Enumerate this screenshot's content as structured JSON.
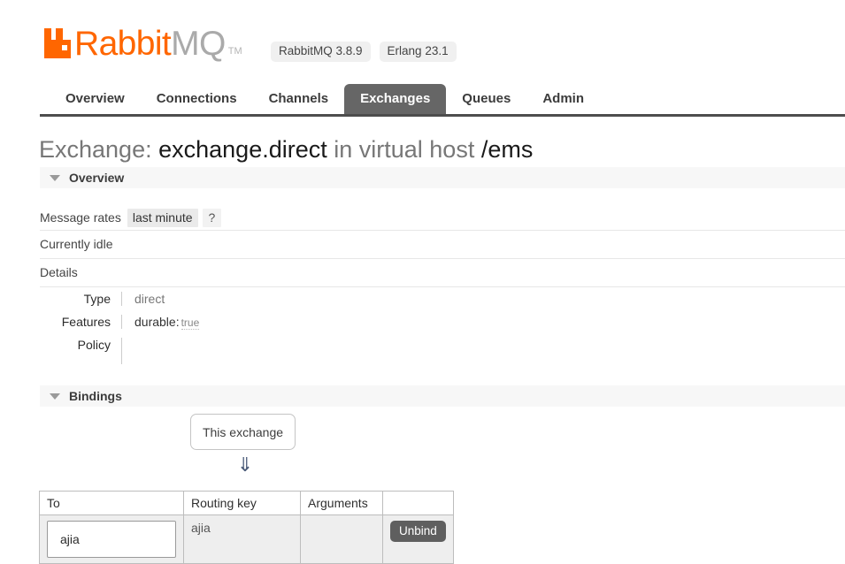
{
  "header": {
    "logo": {
      "icon_name": "rabbitmq-logo-icon",
      "text_primary": "Rabbit",
      "text_secondary": "MQ",
      "trademark": "TM",
      "color": "#ff6600"
    },
    "badges": [
      {
        "label": "RabbitMQ 3.8.9"
      },
      {
        "label": "Erlang 23.1"
      }
    ]
  },
  "nav": {
    "tabs": [
      {
        "label": "Overview",
        "active": false
      },
      {
        "label": "Connections",
        "active": false
      },
      {
        "label": "Channels",
        "active": false
      },
      {
        "label": "Exchanges",
        "active": true
      },
      {
        "label": "Queues",
        "active": false
      },
      {
        "label": "Admin",
        "active": false
      }
    ],
    "active_color": "#666666"
  },
  "page_title": {
    "prefix": "Exchange:",
    "name": "exchange.direct",
    "middle": "in virtual host",
    "vhost": "/ems"
  },
  "overview": {
    "section_label": "Overview",
    "toggle_icon": "triangle-down-icon",
    "message_rates_label": "Message rates",
    "message_rates_value": "last minute",
    "help_label": "?",
    "status": "Currently idle",
    "details_label": "Details",
    "details": [
      {
        "key": "Type",
        "value": "direct"
      },
      {
        "key": "Features",
        "value": "durable:",
        "sub": "true"
      },
      {
        "key": "Policy",
        "value": ""
      }
    ]
  },
  "bindings": {
    "section_label": "Bindings",
    "toggle_icon": "triangle-down-icon",
    "this_exchange_label": "This exchange",
    "arrow_icon": "double-down-arrow-icon",
    "columns": [
      "To",
      "Routing key",
      "Arguments",
      ""
    ],
    "rows": [
      {
        "to": "ajia",
        "routing_key": "ajia",
        "arguments": "",
        "action": "Unbind"
      }
    ]
  }
}
